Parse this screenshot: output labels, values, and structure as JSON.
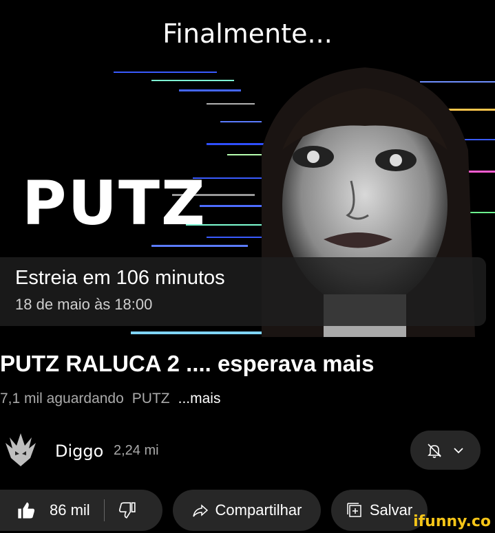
{
  "meme_caption": "Finalmente...",
  "thumbnail": {
    "brand_text": "PUTZ",
    "premiere_title": "Estreia em 106 minutos",
    "premiere_date": "18 de maio às 18:00"
  },
  "video": {
    "title": "PUTZ RALUCA 2 .... esperava mais",
    "waiting": "7,1 mil aguardando",
    "tag": "PUTZ",
    "more": "...mais"
  },
  "channel": {
    "name": "Diggo",
    "subscribers": "2,24 mi",
    "bell_icon": "bell-off-icon",
    "chevron_icon": "chevron-down-icon"
  },
  "actions": {
    "likes": "86 mil",
    "share_label": "Compartilhar",
    "save_label": "Salvar"
  },
  "watermark": "ifunny.co",
  "colors": {
    "background": "#000000",
    "pill": "#272727",
    "watermark": "#f5c518"
  }
}
